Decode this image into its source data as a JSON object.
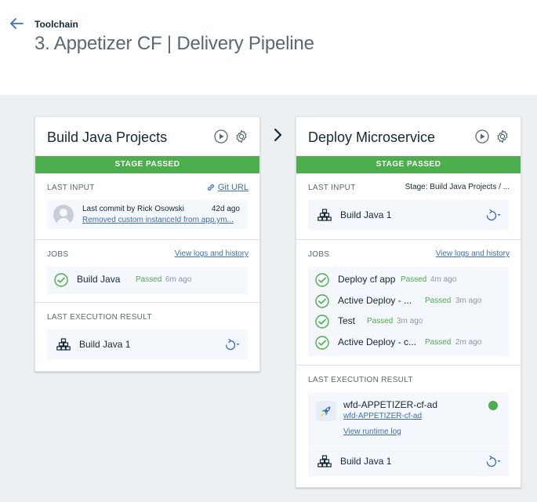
{
  "header": {
    "breadcrumb": "Toolchain",
    "title": "3. Appetizer CF | Delivery Pipeline"
  },
  "colors": {
    "passed": "#4cae4c",
    "link": "#3d70b2",
    "canvas": "#edf0f2"
  },
  "stage1": {
    "name": "Build Java Projects",
    "status": "STAGE PASSED",
    "input_label": "LAST INPUT",
    "input_link": "Git URL",
    "commit_author": "Last commit by Rick Osowski",
    "commit_age": "42d ago",
    "commit_message": "Removed custom instanceId from app.ym...",
    "jobs_label": "JOBS",
    "logs_link": "View logs and history",
    "jobs": [
      {
        "name": "Build Java",
        "status": "Passed",
        "age": "6m ago"
      }
    ],
    "result_label": "LAST EXECUTION RESULT",
    "result_build": "Build Java 1"
  },
  "stage2": {
    "name": "Deploy Microservice",
    "status": "STAGE PASSED",
    "input_label": "LAST INPUT",
    "input_source": "Stage: Build Java Projects  /  ...",
    "input_build": "Build Java 1",
    "jobs_label": "JOBS",
    "logs_link": "View logs and history",
    "jobs": [
      {
        "name": "Deploy cf app",
        "status": "Passed",
        "age": "4m ago"
      },
      {
        "name": "Active Deploy - ...",
        "status": "Passed",
        "age": "3m ago"
      },
      {
        "name": "Test",
        "status": "Passed",
        "age": "3m ago"
      },
      {
        "name": "Active Deploy - c...",
        "status": "Passed",
        "age": "2m ago"
      }
    ],
    "result_label": "LAST EXECUTION RESULT",
    "app_name": "wfd-APPETIZER-cf-ad",
    "app_url": "wfd-APPETIZER-cf-ad",
    "runtime_log": "View runtime log",
    "result_build": "Build Java 1"
  },
  "icons": {
    "back": "arrow-left-icon",
    "play": "play-icon",
    "settings": "gear-icon",
    "link": "link-icon",
    "build": "build-stack-icon",
    "redeploy": "redeploy-icon",
    "passed": "check-circle-icon",
    "app": "rocket-icon",
    "next_stage": "chevron-right-icon"
  }
}
